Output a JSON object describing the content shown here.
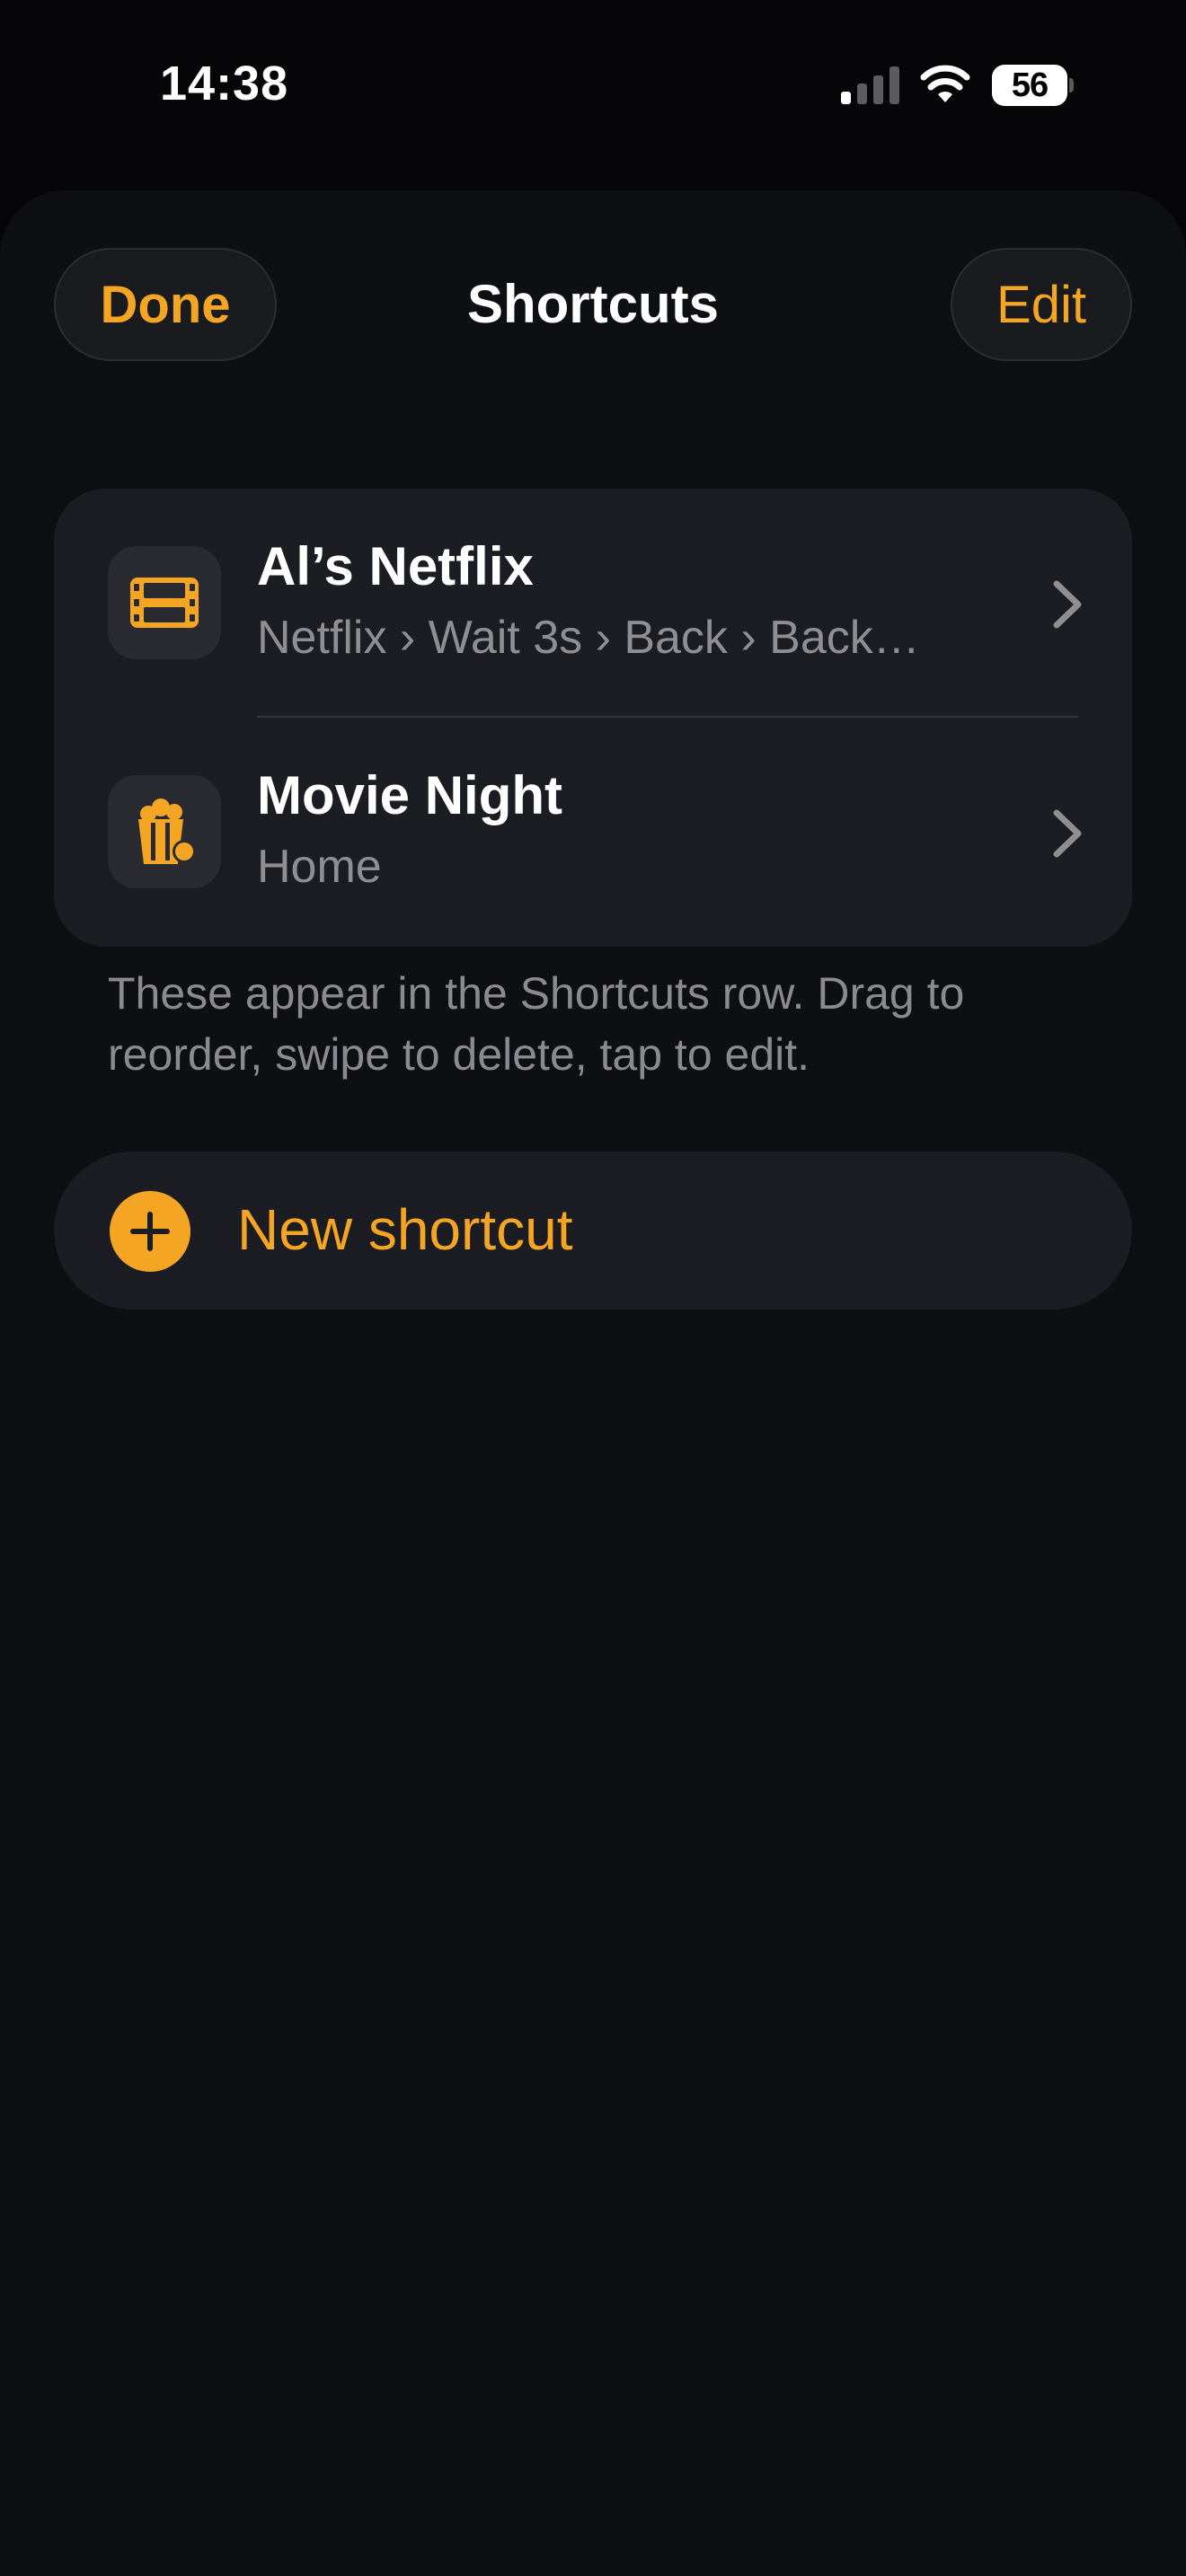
{
  "status_bar": {
    "time": "14:38",
    "battery_level": "56",
    "icons": [
      "cellular-signal-icon",
      "wifi-icon",
      "battery-icon"
    ]
  },
  "header": {
    "done_label": "Done",
    "title": "Shortcuts",
    "edit_label": "Edit"
  },
  "shortcuts": [
    {
      "title": "Al’s Netflix",
      "subtitle": "Netflix › Wait 3s › Back › Back…",
      "icon": "film-icon"
    },
    {
      "title": "Movie Night",
      "subtitle": "Home",
      "icon": "popcorn-icon"
    }
  ],
  "footnote": "These appear in the Shortcuts row. Drag to reorder, swipe to delete, tap to edit.",
  "new_shortcut": {
    "label": "New shortcut",
    "icon": "plus-circle-icon"
  },
  "colors": {
    "accent": "#f5a524",
    "background": "#0e0f12",
    "card": "#1c1d22",
    "secondary_text": "#8e8e93"
  }
}
